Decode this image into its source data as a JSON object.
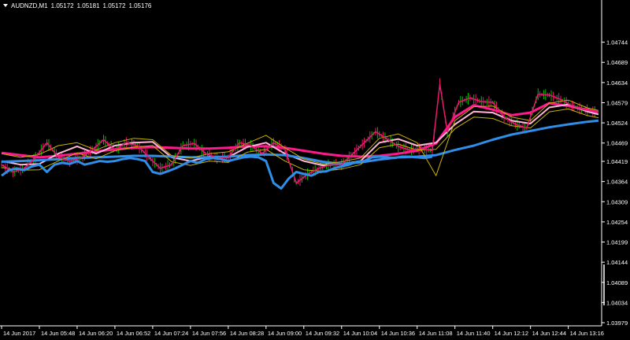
{
  "chart_header": {
    "symbol": "AUDNZD,M1",
    "open": "1.05172",
    "high": "1.05181",
    "low": "1.05172",
    "close": "1.05176"
  },
  "colors": {
    "background": "#000000",
    "axis": "#ffffff",
    "bull_candle": "#00c000",
    "bear_candle": "#e8186e",
    "ma_fast": "#ff1a8c",
    "ma_mid": "#ffb6d9",
    "ma_slow": "#2f8ee8",
    "envelope": "#c8b400"
  },
  "chart_data": {
    "type": "line",
    "title": "",
    "xlabel": "",
    "ylabel": "",
    "ylim": [
      1.03979,
      1.04799
    ],
    "y_ticks": [
      1.04744,
      1.04689,
      1.04634,
      1.04579,
      1.04524,
      1.04469,
      1.04419,
      1.04364,
      1.04309,
      1.04254,
      1.04199,
      1.04144,
      1.04089,
      1.04034,
      1.03979
    ],
    "x_ticks": [
      "14 Jun 2017",
      "14 Jun 05:48",
      "14 Jun 06:20",
      "14 Jun 06:52",
      "14 Jun 07:24",
      "14 Jun 07:56",
      "14 Jun 08:28",
      "14 Jun 09:00",
      "14 Jun 09:32",
      "14 Jun 10:04",
      "14 Jun 10:36",
      "14 Jun 11:08",
      "14 Jun 11:40",
      "14 Jun 12:12",
      "14 Jun 12:44",
      "14 Jun 13:16"
    ],
    "x_range": [
      0,
      15.8
    ],
    "grid": false,
    "series": [
      {
        "color": "#ff1a8c",
        "x": [
          0,
          0.5,
          1,
          1.5,
          2,
          2.5,
          3,
          3.5,
          4,
          4.5,
          5,
          5.5,
          6,
          6.5,
          7,
          7.5,
          8,
          8.5,
          9,
          9.5,
          10,
          10.5,
          11,
          11.5,
          12,
          12.5,
          13,
          13.5,
          14,
          14.5,
          15,
          15.5,
          15.8
        ],
        "y": [
          1.04442,
          1.04436,
          1.0443,
          1.04434,
          1.0444,
          1.04446,
          1.04452,
          1.04456,
          1.04458,
          1.04456,
          1.04454,
          1.04454,
          1.04456,
          1.0446,
          1.0446,
          1.04456,
          1.04448,
          1.0444,
          1.04434,
          1.04432,
          1.04434,
          1.0444,
          1.04448,
          1.04468,
          1.0454,
          1.04572,
          1.0456,
          1.04545,
          1.04552,
          1.04578,
          1.0457,
          1.0456,
          1.04553
        ]
      },
      {
        "color": "#ffb6d9",
        "x": [
          0,
          0.5,
          1,
          1.5,
          2,
          2.5,
          3,
          3.5,
          4,
          4.5,
          5,
          5.5,
          6,
          6.5,
          7,
          7.5,
          8,
          8.5,
          9,
          9.5,
          10,
          10.5,
          11,
          11.5,
          12,
          12.5,
          13,
          13.5,
          14,
          14.5,
          15,
          15.5,
          15.8
        ],
        "y": [
          1.0442,
          1.0441,
          1.04412,
          1.0444,
          1.0446,
          1.0444,
          1.04462,
          1.0447,
          1.04472,
          1.0443,
          1.0442,
          1.04432,
          1.0443,
          1.04458,
          1.0447,
          1.0444,
          1.0442,
          1.04408,
          1.04412,
          1.0442,
          1.0447,
          1.0448,
          1.04462,
          1.0447,
          1.0452,
          1.04555,
          1.04552,
          1.0453,
          1.04522,
          1.04566,
          1.04574,
          1.04555,
          1.04547
        ]
      },
      {
        "color": "#2f8ee8",
        "x": [
          0,
          0.5,
          1,
          1.5,
          2,
          2.5,
          3,
          3.5,
          4,
          4.5,
          5,
          5.5,
          6,
          6.5,
          7,
          7.5,
          8,
          8.5,
          9,
          9.5,
          10,
          10.5,
          11,
          11.5,
          12,
          12.5,
          13,
          13.5,
          14,
          14.5,
          15,
          15.5,
          15.8
        ],
        "y": [
          1.04418,
          1.0442,
          1.04422,
          1.04425,
          1.04428,
          1.0443,
          1.04432,
          1.04434,
          1.04434,
          1.04432,
          1.0443,
          1.0443,
          1.04432,
          1.04436,
          1.04438,
          1.04436,
          1.04428,
          1.04418,
          1.04412,
          1.04416,
          1.04424,
          1.0443,
          1.04432,
          1.04436,
          1.0445,
          1.04462,
          1.04478,
          1.04492,
          1.04502,
          1.04512,
          1.0452,
          1.04527,
          1.0453
        ]
      },
      {
        "color": "#c8b400",
        "x": [
          0,
          0.5,
          1,
          1.5,
          2,
          2.5,
          3,
          3.5,
          4,
          4.5,
          5,
          5.5,
          6,
          6.5,
          7,
          7.5,
          8,
          8.5,
          9,
          9.5,
          10,
          10.5,
          11,
          11.5,
          12,
          12.5,
          13,
          13.5,
          14,
          14.5,
          15,
          15.5,
          15.8
        ],
        "y": [
          1.0444,
          1.0443,
          1.04438,
          1.04462,
          1.0447,
          1.0445,
          1.0447,
          1.04482,
          1.04478,
          1.04435,
          1.04428,
          1.0444,
          1.04445,
          1.04468,
          1.0449,
          1.04456,
          1.04425,
          1.04412,
          1.04418,
          1.04428,
          1.04482,
          1.04494,
          1.0447,
          1.0438,
          1.0453,
          1.04568,
          1.0457,
          1.0454,
          1.0453,
          1.04578,
          1.04586,
          1.04565,
          1.04558
        ]
      },
      {
        "color": "#c8b400",
        "x": [
          0,
          0.5,
          1,
          1.5,
          2,
          2.5,
          3,
          3.5,
          4,
          4.5,
          5,
          5.5,
          6,
          6.5,
          7,
          7.5,
          8,
          8.5,
          9,
          9.5,
          10,
          10.5,
          11,
          11.5,
          12,
          12.5,
          13,
          13.5,
          14,
          14.5,
          15,
          15.5,
          15.8
        ],
        "y": [
          1.04402,
          1.04395,
          1.04396,
          1.0442,
          1.04442,
          1.04426,
          1.04448,
          1.04458,
          1.04462,
          1.04418,
          1.04408,
          1.0442,
          1.04416,
          1.04444,
          1.04452,
          1.0442,
          1.04396,
          1.04392,
          1.04398,
          1.0441,
          1.04456,
          1.04466,
          1.0445,
          1.04452,
          1.04508,
          1.0454,
          1.04536,
          1.04516,
          1.0451,
          1.04554,
          1.04562,
          1.04544,
          1.04538
        ]
      },
      {
        "color": "#e8186e",
        "x": [
          0,
          0.3,
          0.6,
          0.9,
          1.2,
          1.5,
          1.8,
          2.1,
          2.4,
          2.7,
          3,
          3.3,
          3.6,
          3.9,
          4.2,
          4.5,
          4.8,
          5.1,
          5.4,
          5.7,
          6,
          6.3,
          6.6,
          6.9,
          7.2,
          7.5,
          7.8,
          8.1,
          8.4,
          8.7,
          9,
          9.3,
          9.6,
          9.9,
          10.2,
          10.5,
          10.8,
          11.1,
          11.4,
          11.6,
          11.8,
          12.1,
          12.4,
          12.7,
          13,
          13.3,
          13.6,
          13.9,
          14.2,
          14.5,
          14.8,
          15.1,
          15.4,
          15.8
        ],
        "y": [
          1.0441,
          1.0439,
          1.044,
          1.0443,
          1.0447,
          1.0443,
          1.0442,
          1.04428,
          1.0445,
          1.04478,
          1.0445,
          1.0447,
          1.04462,
          1.0443,
          1.044,
          1.0441,
          1.04462,
          1.04468,
          1.0444,
          1.04428,
          1.0443,
          1.0447,
          1.04462,
          1.0444,
          1.0447,
          1.04452,
          1.0436,
          1.04384,
          1.044,
          1.0441,
          1.0441,
          1.0444,
          1.0447,
          1.045,
          1.0448,
          1.0446,
          1.0445,
          1.04454,
          1.04448,
          1.0463,
          1.045,
          1.0458,
          1.04592,
          1.04582,
          1.0458,
          1.0454,
          1.0452,
          1.0451,
          1.04602,
          1.046,
          1.04588,
          1.0457,
          1.0456,
          1.04553
        ]
      },
      {
        "color": "#2f8ee8",
        "x": [
          0,
          0.2,
          0.4,
          0.6,
          0.8,
          1,
          1.2,
          1.4,
          1.6,
          1.8,
          2,
          2.2,
          2.4,
          2.6,
          2.8,
          3,
          3.2,
          3.4,
          3.6,
          3.8,
          4,
          4.2,
          4.4,
          4.6,
          4.8,
          5,
          5.2,
          5.4,
          5.6,
          5.8,
          6,
          6.2,
          6.4,
          6.6,
          6.8,
          7,
          7.2,
          7.4,
          7.6,
          7.8,
          8,
          8.2,
          8.4,
          8.6,
          8.8,
          9,
          9.2,
          9.4,
          9.6,
          9.8,
          10,
          10.2,
          10.4,
          10.6,
          10.8,
          11,
          11.2,
          11.4
        ],
        "y": [
          1.0438,
          1.04395,
          1.044,
          1.04395,
          1.04405,
          1.0441,
          1.0439,
          1.0441,
          1.04415,
          1.04412,
          1.0442,
          1.0441,
          1.04415,
          1.0442,
          1.04418,
          1.0442,
          1.04425,
          1.04428,
          1.04425,
          1.0442,
          1.0439,
          1.04385,
          1.04392,
          1.044,
          1.0441,
          1.0442,
          1.04415,
          1.04425,
          1.04428,
          1.04425,
          1.0442,
          1.04425,
          1.0443,
          1.04432,
          1.0443,
          1.0442,
          1.0436,
          1.04345,
          1.04372,
          1.0439,
          1.04385,
          1.0438,
          1.0439,
          1.04392,
          1.044,
          1.04405,
          1.0441,
          1.04418,
          1.0442,
          1.0443,
          1.04432,
          1.0443,
          1.04428,
          1.04432,
          1.04432,
          1.0443,
          1.04428,
          1.04432
        ]
      }
    ]
  }
}
